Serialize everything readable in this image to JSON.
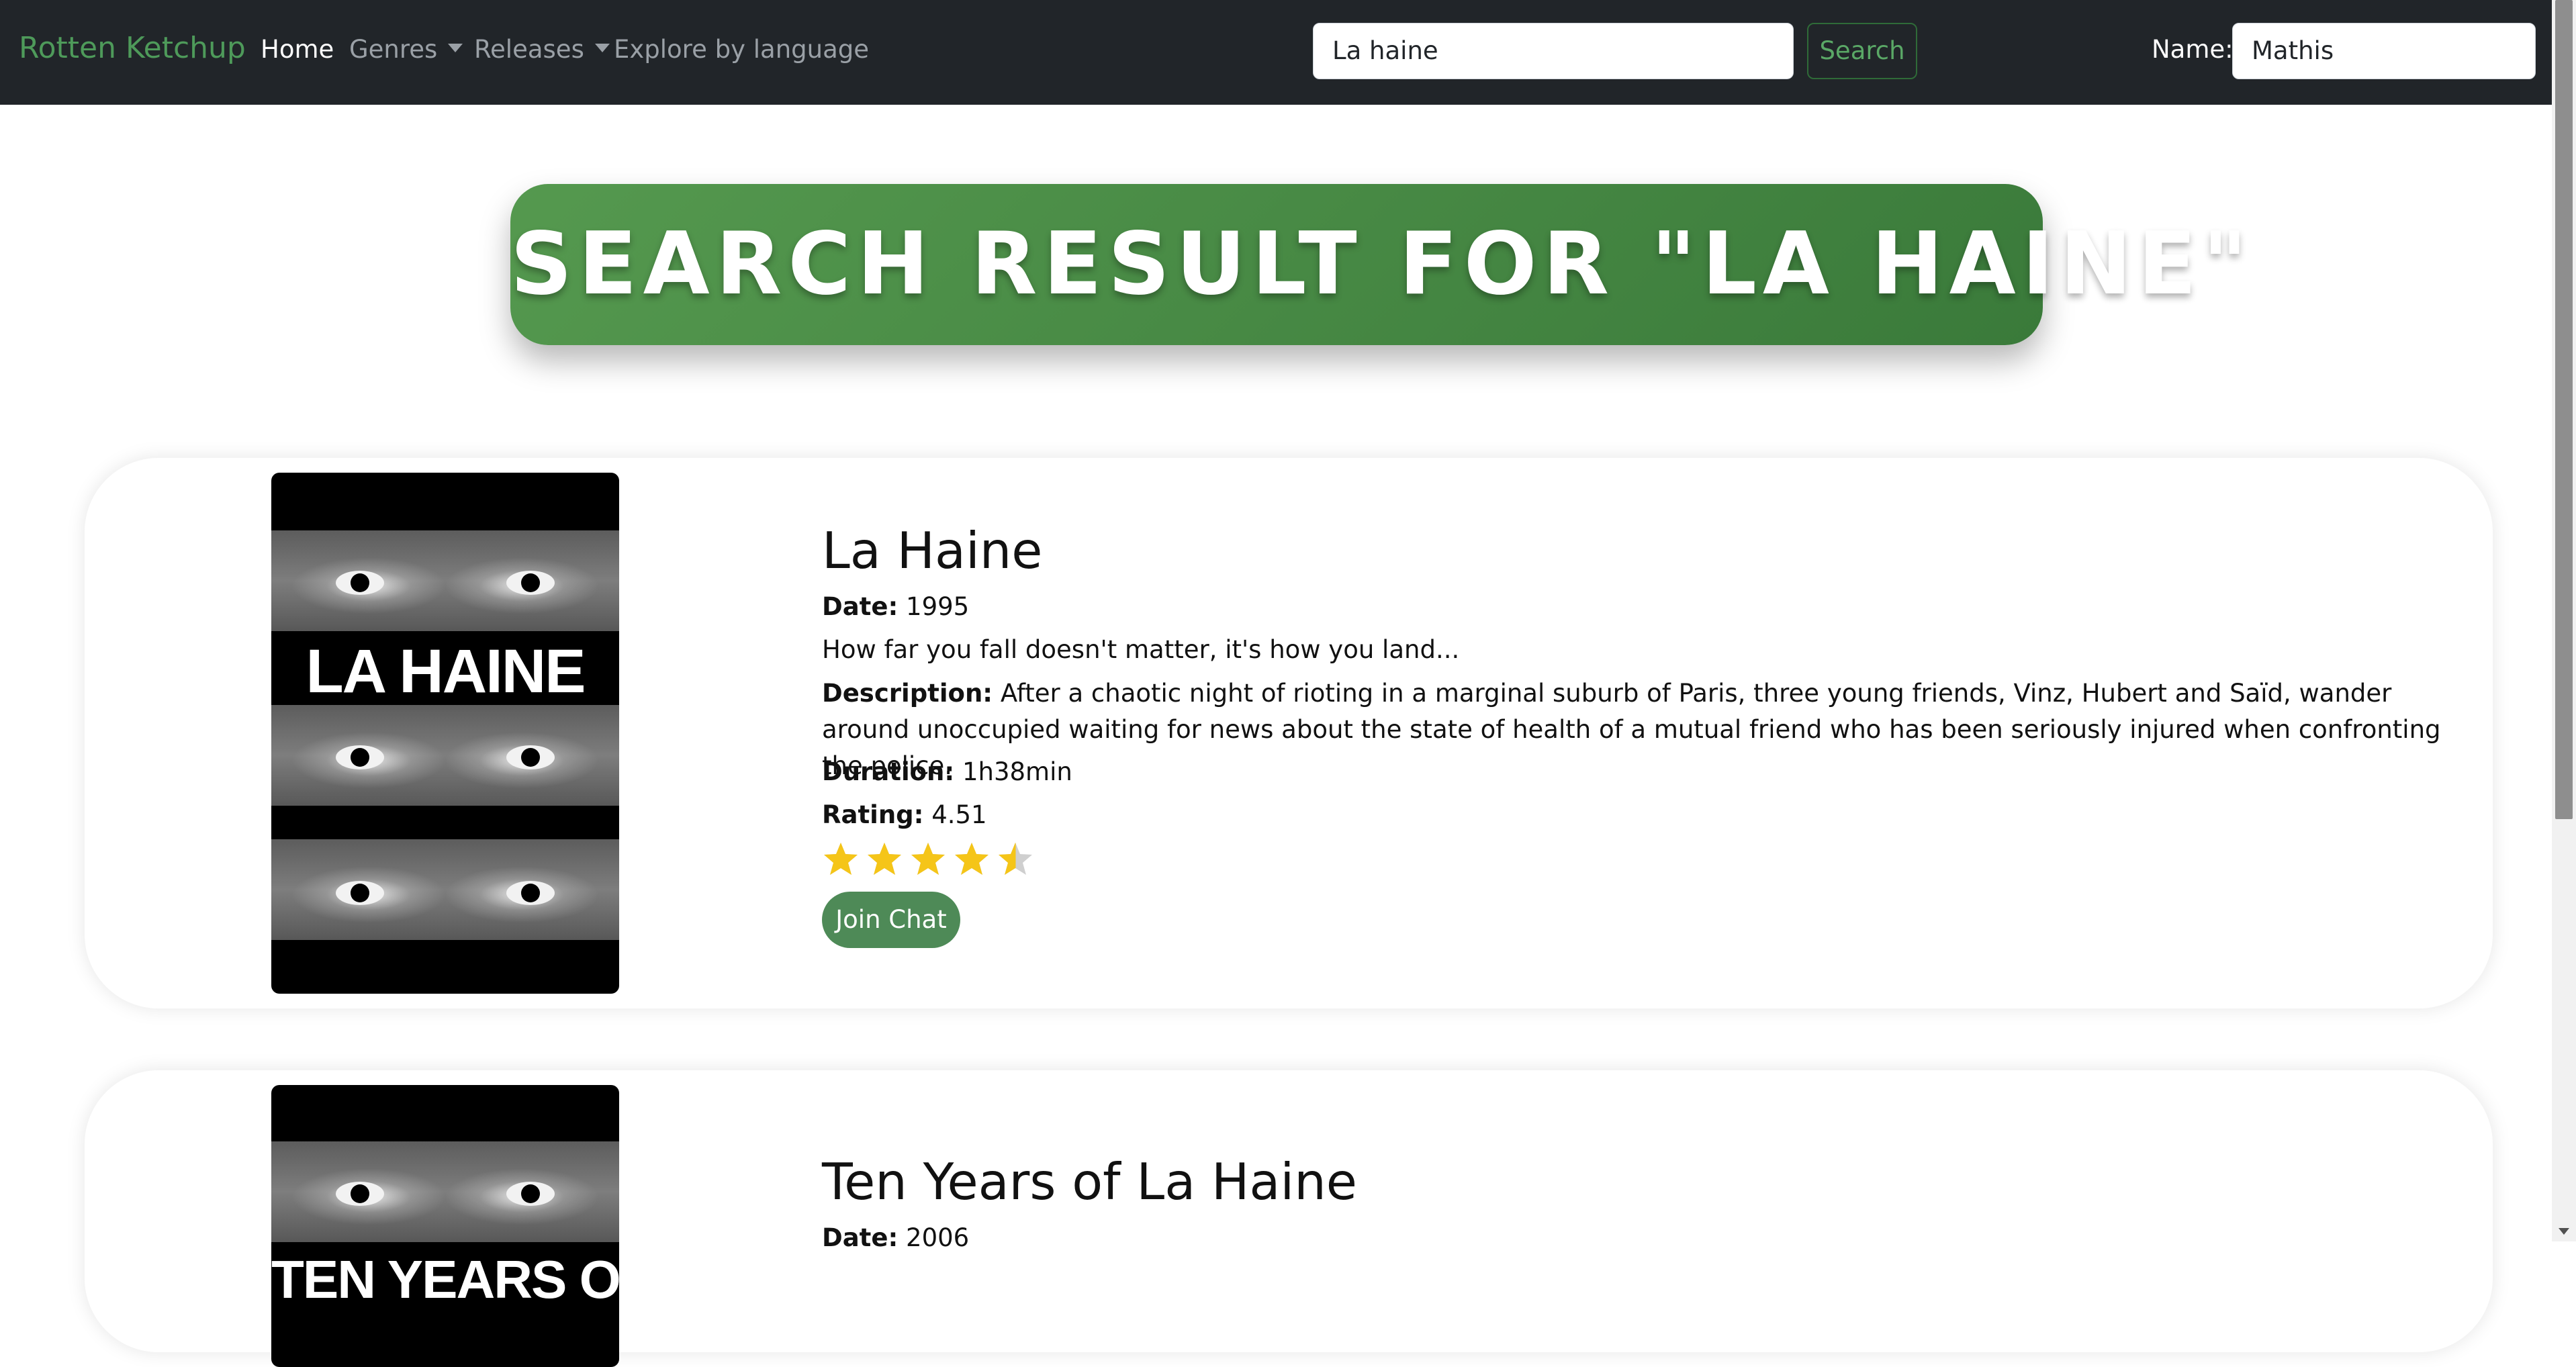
{
  "navbar": {
    "brand": "Rotten Ketchup",
    "links": [
      "Home",
      "Genres",
      "Releases",
      "Explore by language"
    ],
    "search_value": "La haine",
    "search_button": "Search",
    "name_label": "Name:",
    "name_value": "Mathis"
  },
  "banner": {
    "title": "SEARCH RESULT FOR \"LA HAINE\""
  },
  "results": [
    {
      "poster_text": "LA HAINE",
      "title": "La Haine",
      "date_label": "Date:",
      "date": "1995",
      "tagline": "How far you fall doesn't matter, it's how you land...",
      "description_label": "Description:",
      "description": "After a chaotic night of rioting in a marginal suburb of Paris, three young friends, Vinz, Hubert and Saïd, wander around unoccupied waiting for news about the state of health of a mutual friend who has been seriously injured when confronting the police.",
      "duration_label": "Duration:",
      "duration": "1h38min",
      "rating_label": "Rating:",
      "rating": "4.51",
      "rating_value": 4.51,
      "join_button": "Join Chat"
    },
    {
      "poster_text": "TEN YEARS OF",
      "title": "Ten Years of La Haine",
      "date_label": "Date:",
      "date": "2006"
    }
  ],
  "colors": {
    "navbar": "#212529",
    "brand": "#4e9a5a",
    "banner": "#4a8a45",
    "star": "#f5c518",
    "button": "#4e8a57"
  }
}
